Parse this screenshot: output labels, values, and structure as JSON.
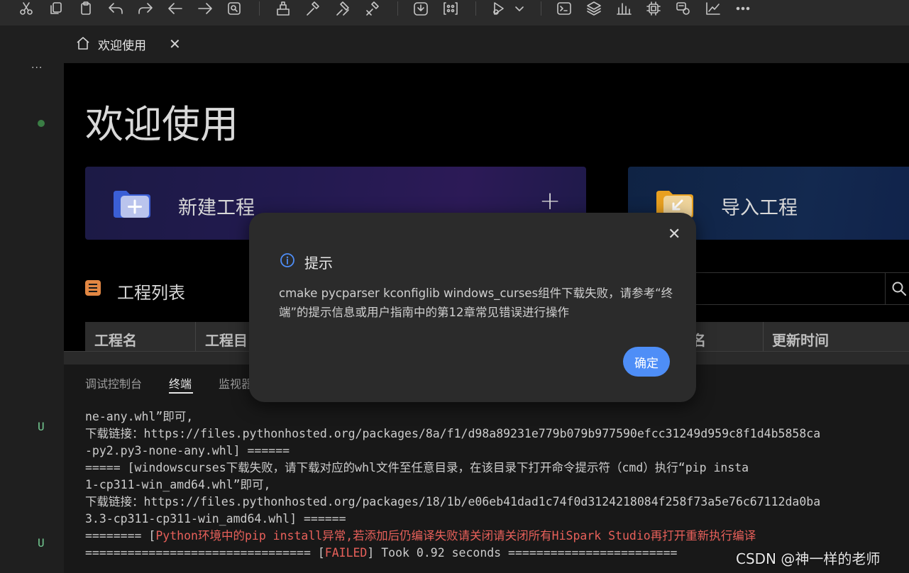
{
  "toolbar": {
    "icons": [
      "cut-icon",
      "copy-icon",
      "paste-icon",
      "undo-icon",
      "redo-icon",
      "back-icon",
      "forward-icon",
      "find-icon",
      "build-icon",
      "rebuild-icon",
      "clean-icon",
      "stop-build-icon",
      "download-icon",
      "flash-icon",
      "debug-icon",
      "dropdown-icon",
      "terminal-icon",
      "layers-icon",
      "stats-icon",
      "chip-icon",
      "tools-icon",
      "chart-icon",
      "more-icon"
    ]
  },
  "activity": {
    "more": "···",
    "git_status": [
      "U",
      "U"
    ]
  },
  "tab": {
    "label": "欢迎使用",
    "close": "✕"
  },
  "welcome": {
    "title": "欢迎使用",
    "new_project": "新建工程",
    "new_project_plus": "+",
    "import_project": "导入工程",
    "project_list": "工程列表",
    "columns": [
      "工程名",
      "工程目",
      "名",
      "更新时间"
    ]
  },
  "panel": {
    "tabs": [
      "调试控制台",
      "终端",
      "监视器"
    ],
    "terminal_lines": [
      {
        "text": "ne-any.whl”即可,"
      },
      {
        "text": "下载链接：https://files.pythonhosted.org/packages/8a/f1/d98a89231e779b079b977590efcc31249d959c8f1d4b5858ca"
      },
      {
        "text": "-py2.py3-none-any.whl] ======"
      },
      {
        "text": "===== [windowscurses下载失败，请下载对应的whl文件至任意目录，在该目录下打开命令提示符（cmd）执行“pip insta"
      },
      {
        "text": "1-cp311-win_amd64.whl”即可,"
      },
      {
        "text": "下载链接：https://files.pythonhosted.org/packages/18/1b/e06eb41dad1c74f0d3124218084f258f73a5e76c67112da0ba"
      },
      {
        "text": "3.3-cp311-cp311-win_amd64.whl] ======"
      }
    ],
    "line8_prefix": "======== [",
    "line8_red": "Python环境中的pip install异常,若添加后仍编译失败请关闭请关闭所有HiSpark Studio再打开重新执行编译",
    "line9_prefix": "================================ [",
    "line9_red": "FAILED",
    "line9_suffix": "] Took 0.92 seconds ========================"
  },
  "modal": {
    "title": "提示",
    "message": "cmake pycparser kconfiglib windows_curses组件下载失败，请参考“终端”的提示信息或用户指南中的第12章常见错误进行操作",
    "ok": "确定",
    "close": "✕"
  },
  "watermark": "CSDN @神一样的老师",
  "colors": {
    "accent": "#4e8ef7",
    "error": "#e8605a",
    "git_untracked": "#73c991"
  }
}
